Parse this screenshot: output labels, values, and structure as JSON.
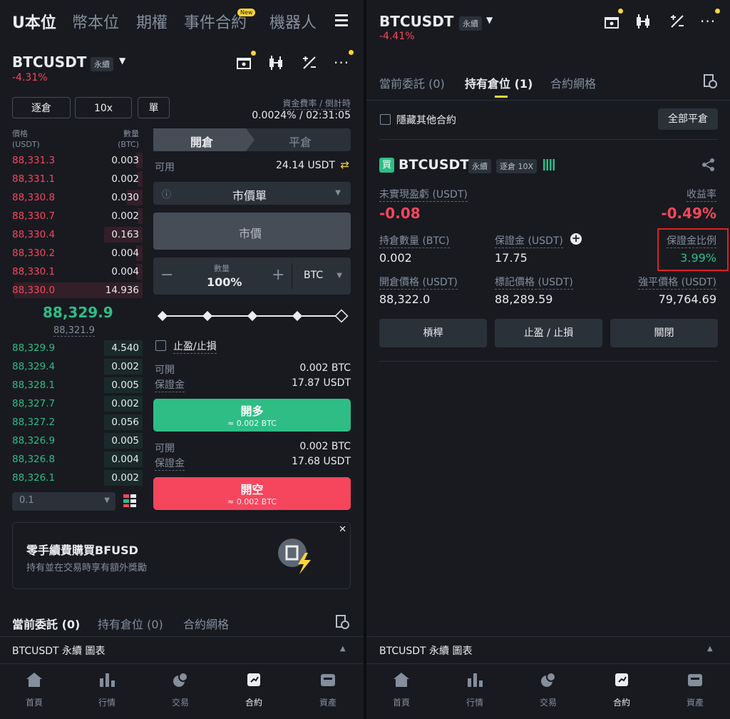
{
  "left": {
    "nav": {
      "tabs": [
        "U本位",
        "幣本位",
        "期權",
        "事件合約",
        "機器人"
      ],
      "new_badge": "New"
    },
    "symbol": "BTCUSDT",
    "perp_label": "永續",
    "change": "-4.31%",
    "margin_mode": "逐倉",
    "leverage": "10x",
    "position_mode": "單",
    "funding_label": "資金費率 / 倒計時",
    "funding_value": "0.0024% / 02:31:05",
    "orderbook": {
      "price_header": "價格",
      "price_unit": "(USDT)",
      "qty_header": "數量",
      "qty_unit": "(BTC)",
      "asks": [
        {
          "p": "88,331.3",
          "q": "0.003",
          "d": 0.05
        },
        {
          "p": "88,331.1",
          "q": "0.002",
          "d": 0.04
        },
        {
          "p": "88,330.8",
          "q": "0.030",
          "d": 0.12
        },
        {
          "p": "88,330.7",
          "q": "0.002",
          "d": 0.04
        },
        {
          "p": "88,330.4",
          "q": "0.163",
          "d": 0.3
        },
        {
          "p": "88,330.2",
          "q": "0.004",
          "d": 0.05
        },
        {
          "p": "88,330.1",
          "q": "0.004",
          "d": 0.05
        },
        {
          "p": "88,330.0",
          "q": "14.936",
          "d": 1.0
        }
      ],
      "last_price": "88,329.9",
      "mark_price": "88,321.9",
      "bids": [
        {
          "p": "88,329.9",
          "q": "4.540",
          "d": 0.3
        },
        {
          "p": "88,329.4",
          "q": "0.002",
          "d": 0.3
        },
        {
          "p": "88,328.1",
          "q": "0.005",
          "d": 0.3
        },
        {
          "p": "88,327.7",
          "q": "0.002",
          "d": 0.3
        },
        {
          "p": "88,327.2",
          "q": "0.056",
          "d": 0.3
        },
        {
          "p": "88,326.9",
          "q": "0.005",
          "d": 0.3
        },
        {
          "p": "88,326.8",
          "q": "0.004",
          "d": 0.3
        },
        {
          "p": "88,326.1",
          "q": "0.002",
          "d": 0.3
        }
      ],
      "precision": "0.1"
    },
    "form": {
      "open_tab": "開倉",
      "close_tab": "平倉",
      "available_label": "可用",
      "available_value": "24.14 USDT",
      "order_type": "市價單",
      "price_placeholder": "市價",
      "qty_label": "數量",
      "qty_value": "100%",
      "qty_unit": "BTC",
      "tpsl_label": "止盈/止損",
      "long_can_open_label": "可開",
      "long_can_open": "0.002 BTC",
      "long_margin_label": "保證金",
      "long_margin": "17.87 USDT",
      "long_button": "開多",
      "long_sub": "≈ 0.002 BTC",
      "short_can_open_label": "可開",
      "short_can_open": "0.002 BTC",
      "short_margin_label": "保證金",
      "short_margin": "17.68 USDT",
      "short_button": "開空",
      "short_sub": "≈ 0.002 BTC"
    },
    "promo": {
      "title": "零手續費購買BFUSD",
      "subtitle": "持有並在交易時享有額外獎勵"
    },
    "bottom_tabs": [
      "當前委託 (0)",
      "持有倉位 (0)",
      "合約網格"
    ],
    "chart_bar": "BTCUSDT 永續  圖表"
  },
  "right": {
    "symbol": "BTCUSDT",
    "perp_label": "永續",
    "change": "-4.41%",
    "tabs": [
      "當前委託 (0)",
      "持有倉位 (1)",
      "合約網格"
    ],
    "hide_other": "隱藏其他合約",
    "close_all": "全部平倉",
    "position": {
      "side": "買",
      "symbol": "BTCUSDT",
      "perp_label": "永續",
      "mode_label": "逐倉 10X",
      "pnl_label": "未實現盈虧 (USDT)",
      "pnl_value": "-0.08",
      "roe_label": "收益率",
      "roe_value": "-0.49%",
      "size_label": "持倉數量 (BTC)",
      "size_value": "0.002",
      "margin_label": "保證金 (USDT)",
      "margin_value": "17.75",
      "ratio_label": "保證金比例",
      "ratio_value": "3.99%",
      "entry_label": "開倉價格 (USDT)",
      "entry_value": "88,322.0",
      "mark_label": "標記價格 (USDT)",
      "mark_value": "88,289.59",
      "liq_label": "強平價格 (USDT)",
      "liq_value": "79,764.69",
      "btn_leverage": "槓桿",
      "btn_tpsl": "止盈 / 止損",
      "btn_close": "關閉"
    },
    "chart_bar": "BTCUSDT 永續  圖表"
  },
  "bottom_nav": [
    "首頁",
    "行情",
    "交易",
    "合約",
    "資產"
  ],
  "colors": {
    "red": "#f6465d",
    "green": "#2ebd85",
    "yellow": "#fcd535",
    "bg": "#181a20"
  }
}
